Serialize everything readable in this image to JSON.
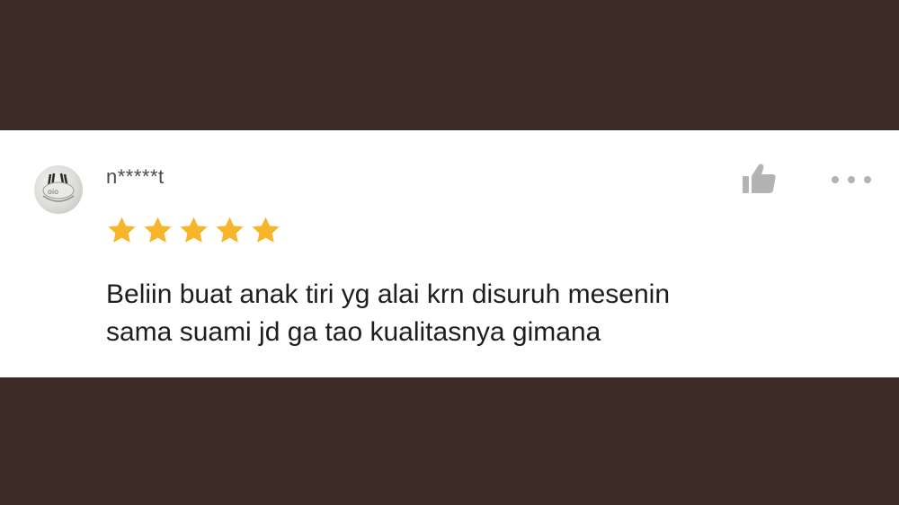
{
  "review": {
    "username": "n*****t",
    "rating": 5,
    "rating_max": 5,
    "text_line1": "Beliin buat anak tiri yg alai krn disuruh mesenin",
    "text_line2": "sama suami jd ga tao kualitasnya gimana"
  },
  "icons": {
    "like": "thumbs-up-icon",
    "more": "more-horizontal-icon",
    "star": "star-icon"
  },
  "colors": {
    "background": "#3d2b28",
    "card": "#ffffff",
    "star": "#f7b52a",
    "icon": "#b3b3b3",
    "text": "#1e1e1e",
    "username": "#4a4a4a"
  }
}
